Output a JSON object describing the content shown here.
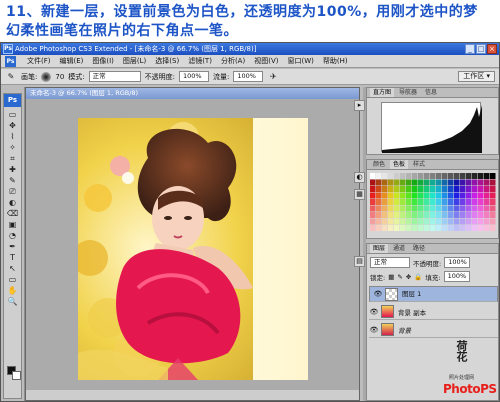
{
  "caption": {
    "line1": "11、新建一层，设置前景色为白色，还透明度为100%，用刚才选中的梦",
    "line2": "幻柔性画笔在照片的右下角点一笔。"
  },
  "titlebar": {
    "title": "Adobe Photoshop CS3 Extended - [未命名-3 @ 66.7% (图层 1, RGB/8)]",
    "ps": "Ps",
    "minimize": "_",
    "maximize": "□",
    "close": "×"
  },
  "menu": {
    "ps": "Ps",
    "items": [
      "文件(F)",
      "编辑(E)",
      "图像(I)",
      "图层(L)",
      "选择(S)",
      "滤镜(T)",
      "分析(A)",
      "视图(V)",
      "窗口(W)",
      "帮助(H)"
    ]
  },
  "options": {
    "brush_label": "画笔:",
    "brush_size": "70",
    "mode_label": "模式:",
    "mode_value": "正常",
    "opacity_label": "不透明度:",
    "opacity_value": "100%",
    "flow_label": "流量:",
    "flow_value": "100%",
    "workspace": "工作区 ▾"
  },
  "toolbox": {
    "logo": "Ps",
    "tools": [
      "▭",
      "✥",
      "⌇",
      "✧",
      "⌗",
      "✚",
      "✎",
      "⎚",
      "◐",
      "⌫",
      "▣",
      "◔",
      "✒",
      "T",
      "↖",
      "▭",
      "✋",
      "🔍"
    ]
  },
  "document": {
    "title": "未命名-3 @ 66.7% (图层 1, RGB/8)"
  },
  "panels": {
    "histogram_tabs": [
      "直方图",
      "导航器",
      "信息"
    ],
    "color_tabs": [
      "颜色",
      "色板",
      "样式"
    ],
    "layers_tabs": [
      "图层",
      "通道",
      "路径"
    ],
    "blend_mode": "正常",
    "opacity_label": "不透明度:",
    "opacity_value": "100%",
    "lock_label": "锁定:",
    "fill_label": "填充:",
    "fill_value": "100%",
    "layers": [
      {
        "name": "图层 1",
        "selected": true
      },
      {
        "name": "背景 副本",
        "selected": false
      },
      {
        "name": "背景",
        "selected": false
      }
    ]
  },
  "branding": {
    "signature": "荷花",
    "site": "照片处理网",
    "logo": "PhotoPS"
  },
  "colors": {
    "caption_blue": "#1d55c7",
    "layer_selected": "#9eb6de"
  }
}
